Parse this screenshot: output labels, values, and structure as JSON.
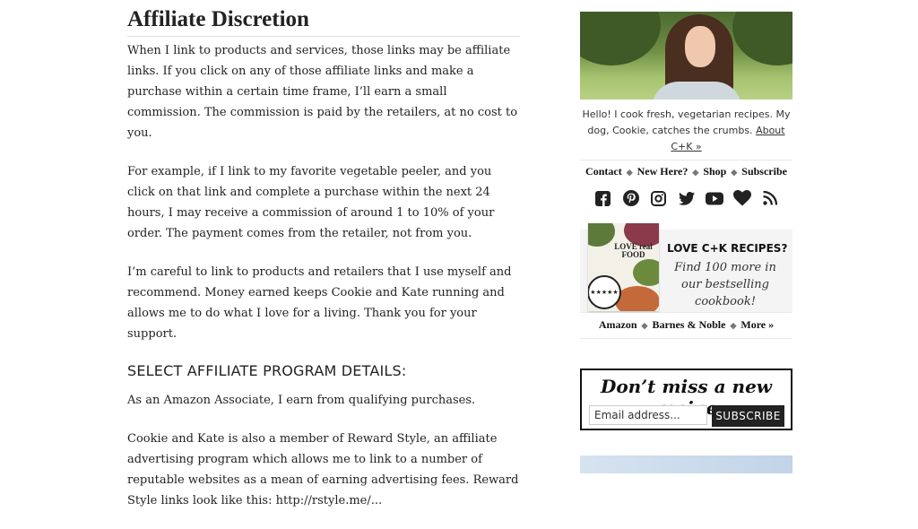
{
  "article": {
    "title": "Affiliate Discretion",
    "paragraphs": [
      "When I link to products and services, those links may be affiliate links. If you click on any of those affiliate links and make a purchase within a certain time frame, I’ll earn a small commission. The commission is paid by the retailers, at no cost to you.",
      "For example, if I link to my favorite vegetable peeler, and you click on that link and complete a purchase within the next 24 hours, I may receive a commission of around 1 to 10% of your order. The payment comes from the retailer, not from you.",
      "I’m careful to link to products and retailers that I use myself and recommend. Money earned keeps Cookie and Kate running and allows me to do what I love for a living. Thank you for your support."
    ],
    "subheading": "SELECT AFFILIATE PROGRAM DETAILS:",
    "paragraphs2": [
      "As an Amazon Associate, I earn from qualifying purchases.",
      "Cookie and Kate is also a member of Reward Style, an affiliate advertising program which allows me to link to a number of reputable websites as a mean of earning advertising fees. Reward Style links look like this: http://rstyle.me/..."
    ]
  },
  "sidebar": {
    "intro_text": "Hello! I cook fresh, vegetarian recipes. My dog, Cookie, catches the crumbs.",
    "about_link": "About C+K »",
    "nav_links": [
      "Contact",
      "New Here?",
      "Shop",
      "Subscribe"
    ],
    "separator": "◆",
    "social_icons": [
      "facebook-icon",
      "pinterest-icon",
      "instagram-icon",
      "twitter-icon",
      "youtube-icon",
      "heart-icon",
      "rss-icon"
    ],
    "promo": {
      "headline": "LOVE C+K RECIPES?",
      "subtext": "Find 100 more in our bestselling cookbook!",
      "book_title": "LOVE real FOOD",
      "rating": "★★★★★",
      "retailers": [
        "Amazon",
        "Barnes & Noble",
        "More »"
      ]
    },
    "newsletter": {
      "headline": "Don’t miss a new recipe",
      "email_placeholder": "Email address...",
      "button_label": "SUBSCRIBE"
    }
  }
}
